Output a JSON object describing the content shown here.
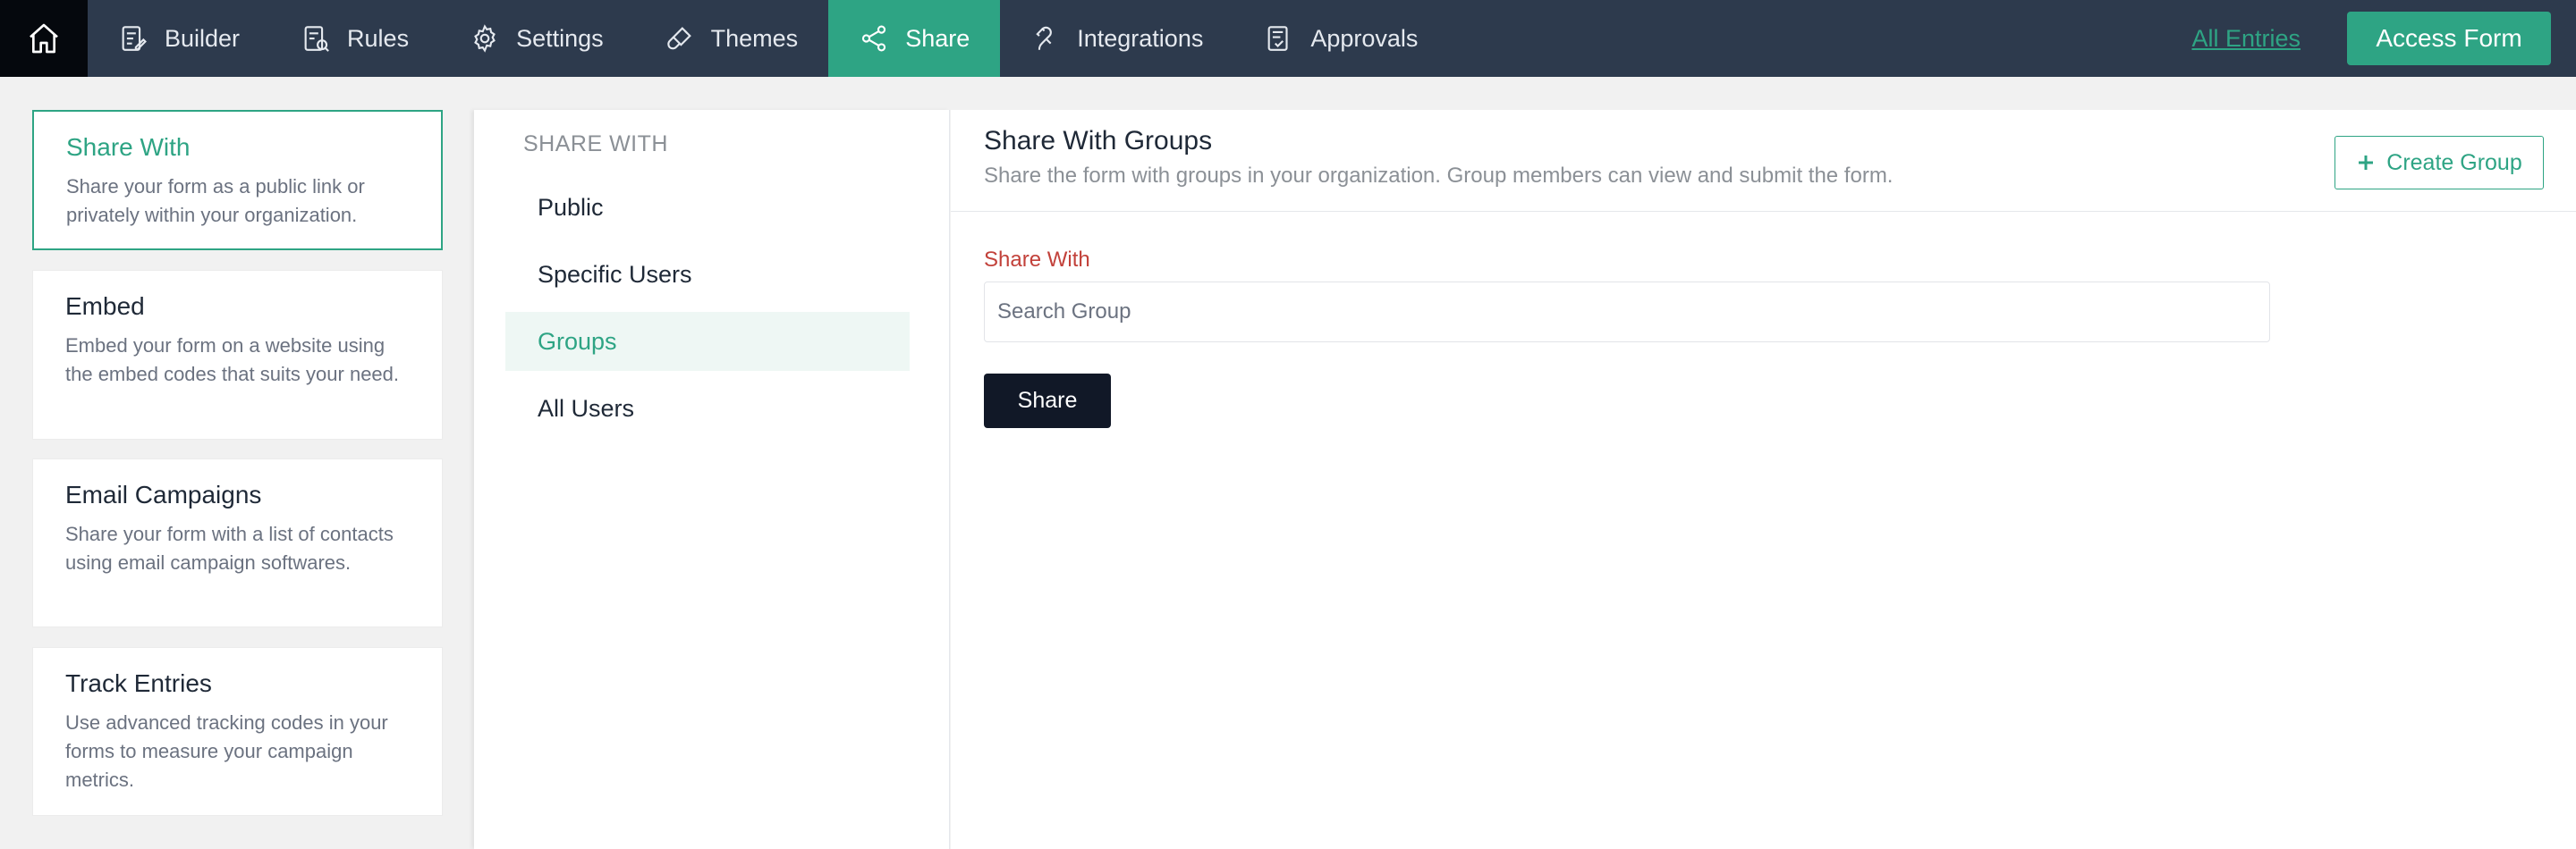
{
  "topnav": {
    "items": [
      {
        "label": "Builder",
        "icon": "builder-icon"
      },
      {
        "label": "Rules",
        "icon": "rules-icon"
      },
      {
        "label": "Settings",
        "icon": "gear-icon"
      },
      {
        "label": "Themes",
        "icon": "brush-icon"
      },
      {
        "label": "Share",
        "icon": "share-icon",
        "active": true
      },
      {
        "label": "Integrations",
        "icon": "plug-icon"
      },
      {
        "label": "Approvals",
        "icon": "approvals-icon"
      }
    ],
    "all_entries": "All Entries",
    "access_form": "Access Form"
  },
  "sidebar": {
    "cards": [
      {
        "title": "Share With",
        "desc": "Share your form as a public link or privately within your organization.",
        "active": true
      },
      {
        "title": "Embed",
        "desc": "Embed your form on a website using the embed codes that suits your need."
      },
      {
        "title": "Email Campaigns",
        "desc": "Share your form with a list of contacts using email campaign softwares."
      },
      {
        "title": "Track Entries",
        "desc": "Use advanced tracking codes in your forms to measure your campaign metrics."
      }
    ]
  },
  "share_with": {
    "heading": "SHARE WITH",
    "options": [
      "Public",
      "Specific Users",
      "Groups",
      "All Users"
    ],
    "selected": "Groups"
  },
  "panel": {
    "title": "Share With Groups",
    "subtitle": "Share the form with groups in your organization. Group members can view and submit the form.",
    "create_group": "Create Group",
    "field_label": "Share With",
    "search_placeholder": "Search Group",
    "share_button": "Share"
  },
  "colors": {
    "accent": "#2ea484",
    "nav_bg": "#2d3a4d",
    "label_red": "#c2413a",
    "dark_button": "#111827"
  }
}
